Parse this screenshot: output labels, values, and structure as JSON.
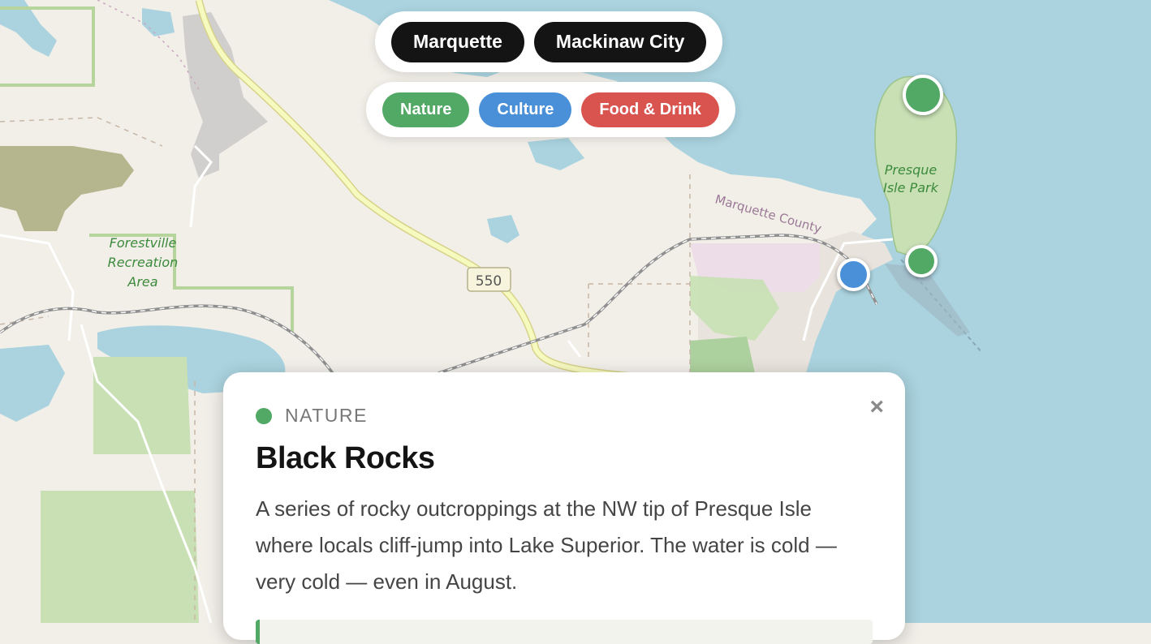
{
  "cities": {
    "marquette": "Marquette",
    "mackinaw": "Mackinaw City"
  },
  "categories": {
    "nature": {
      "label": "Nature",
      "color": "#52a865"
    },
    "culture": {
      "label": "Culture",
      "color": "#4a90d9"
    },
    "food": {
      "label": "Food & Drink",
      "color": "#d9534f"
    }
  },
  "map": {
    "labels": {
      "park1": "Presque",
      "park2": "Isle Park",
      "county": "Marquette County",
      "area1": "Forestville",
      "area2": "Recreation",
      "area3": "Area",
      "highway": "550"
    },
    "colors": {
      "land": "#f2efe9",
      "water": "#aad3df",
      "park": "#c8e0b4",
      "forest": "#add19e",
      "road_major": "#f7fabf",
      "road_casing": "#d6d28a",
      "urban": "#d0cfcd",
      "wetland_lilac": "#e9dce8",
      "dark_forest": "#b7b78f"
    }
  },
  "markers": [
    {
      "category": "nature",
      "name": "presque-isle-north-marker"
    },
    {
      "category": "nature",
      "name": "presque-isle-south-marker"
    },
    {
      "category": "culture",
      "name": "harbor-marker"
    }
  ],
  "card": {
    "category": "Nature",
    "category_color": "#52a865",
    "title": "Black Rocks",
    "description": "A series of rocky outcroppings at the NW tip of Presque Isle where locals cliff-jump into Lake Superior. The water is cold — very cold — even in August.",
    "close": "×"
  }
}
